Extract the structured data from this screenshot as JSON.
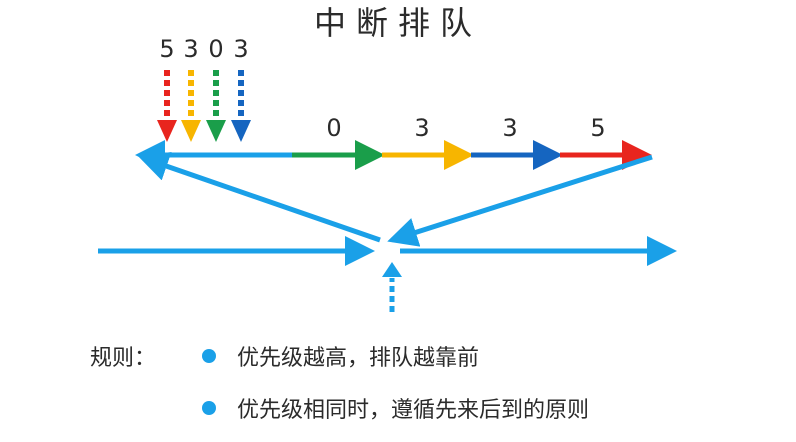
{
  "title": "中断排队",
  "incoming_numbers": [
    "5",
    "3",
    "0",
    "3"
  ],
  "queue_numbers": [
    "0",
    "3",
    "3",
    "5"
  ],
  "rules": {
    "label": "规则：",
    "items": [
      "优先级越高，排队越靠前",
      "优先级相同时，遵循先来后到的原则"
    ]
  },
  "colors": {
    "red": "#e8251e",
    "yellow": "#f7b500",
    "green": "#1a9e4a",
    "blue": "#1565c0",
    "cyan": "#1aa0e8"
  }
}
